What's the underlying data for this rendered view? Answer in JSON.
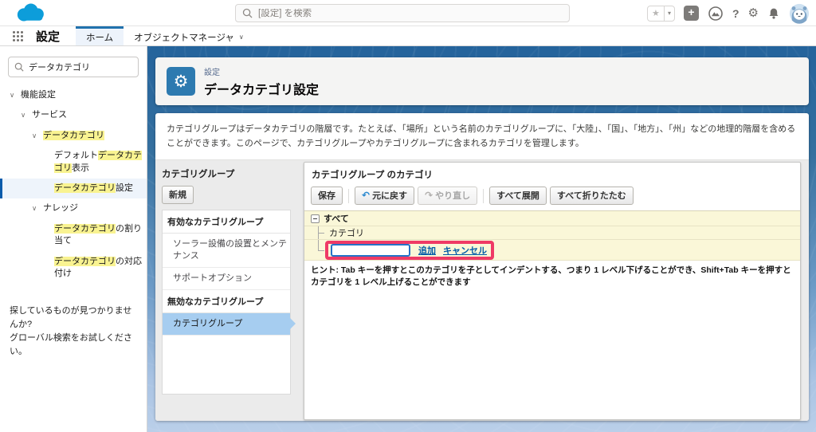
{
  "colors": {
    "brand_blue": "#0d9dda",
    "link_blue": "#015ba7",
    "highlight_yellow": "#f9f391",
    "selection_blue": "#a6cdf0",
    "annotation_pink": "#ef3a66",
    "tab_accent": "#2172ad"
  },
  "global_header": {
    "search_placeholder": "[設定] を検索"
  },
  "nav": {
    "app_label": "設定",
    "tabs": {
      "home": "ホーム",
      "object_manager": "オブジェクトマネージャ"
    }
  },
  "sidebar": {
    "search_value": "データカテゴリ",
    "tree": [
      {
        "level": 0,
        "chevron": true,
        "selected": false,
        "segments": [
          {
            "t": "機能設定",
            "hl": false
          }
        ]
      },
      {
        "level": 1,
        "chevron": true,
        "selected": false,
        "segments": [
          {
            "t": "サービス",
            "hl": false
          }
        ]
      },
      {
        "level": 2,
        "chevron": true,
        "selected": false,
        "segments": [
          {
            "t": "データカテゴリ",
            "hl": true
          }
        ]
      },
      {
        "level": 3,
        "chevron": false,
        "selected": false,
        "segments": [
          {
            "t": "デフォルト",
            "hl": false
          },
          {
            "t": "データカテゴリ",
            "hl": true
          },
          {
            "t": "表示",
            "hl": false
          }
        ]
      },
      {
        "level": 3,
        "chevron": false,
        "selected": true,
        "segments": [
          {
            "t": "データカテゴリ",
            "hl": true
          },
          {
            "t": "設定",
            "hl": false
          }
        ]
      },
      {
        "level": 2,
        "chevron": true,
        "selected": false,
        "segments": [
          {
            "t": "ナレッジ",
            "hl": false
          }
        ]
      },
      {
        "level": 3,
        "chevron": false,
        "selected": false,
        "segments": [
          {
            "t": "データカテゴリ",
            "hl": true
          },
          {
            "t": "の割り当て",
            "hl": false
          }
        ]
      },
      {
        "level": 3,
        "chevron": false,
        "selected": false,
        "segments": [
          {
            "t": "データカテゴリ",
            "hl": true
          },
          {
            "t": "の対応付け",
            "hl": false
          }
        ]
      }
    ],
    "footer": {
      "line1": "探しているものが見つかりませんか?",
      "line2": "グローバル検索をお試しください。"
    }
  },
  "page_header": {
    "eyebrow": "設定",
    "title": "データカテゴリ設定"
  },
  "main": {
    "description": "カテゴリグループはデータカテゴリの階層です。たとえば、「場所」という名前のカテゴリグループに、「大陸」、「国」、「地方」、「州」などの地理的階層を含めることができます。このページで、カテゴリグループやカテゴリグループに含まれるカテゴリを管理します。"
  },
  "group_panel": {
    "title": "カテゴリグループ",
    "new_button": "新規",
    "sections": [
      {
        "header": "有効なカテゴリグループ",
        "items": [
          {
            "label": "ソーラー設備の設置とメンテナンス",
            "selected": false
          },
          {
            "label": "サポートオプション",
            "selected": false
          }
        ]
      },
      {
        "header": "無効なカテゴリグループ",
        "items": [
          {
            "label": "カテゴリグループ",
            "selected": true
          }
        ]
      }
    ]
  },
  "category_panel": {
    "title": "カテゴリグループ のカテゴリ",
    "toolbar": {
      "save": "保存",
      "undo": "元に戻す",
      "redo": "やり直し",
      "expand_all": "すべて展開",
      "collapse_all": "すべて折りたたむ"
    },
    "tree_root": "すべて",
    "tree_child": "カテゴリ",
    "inline_edit": {
      "value": "",
      "add_label": "追加",
      "cancel_label": "キャンセル"
    },
    "hint": "ヒント: Tab キーを押すとこのカテゴリを子としてインデントする、つまり 1 レベル下げることができ、Shift+Tab キーを押すとカテゴリを 1 レベル上げることができます"
  }
}
